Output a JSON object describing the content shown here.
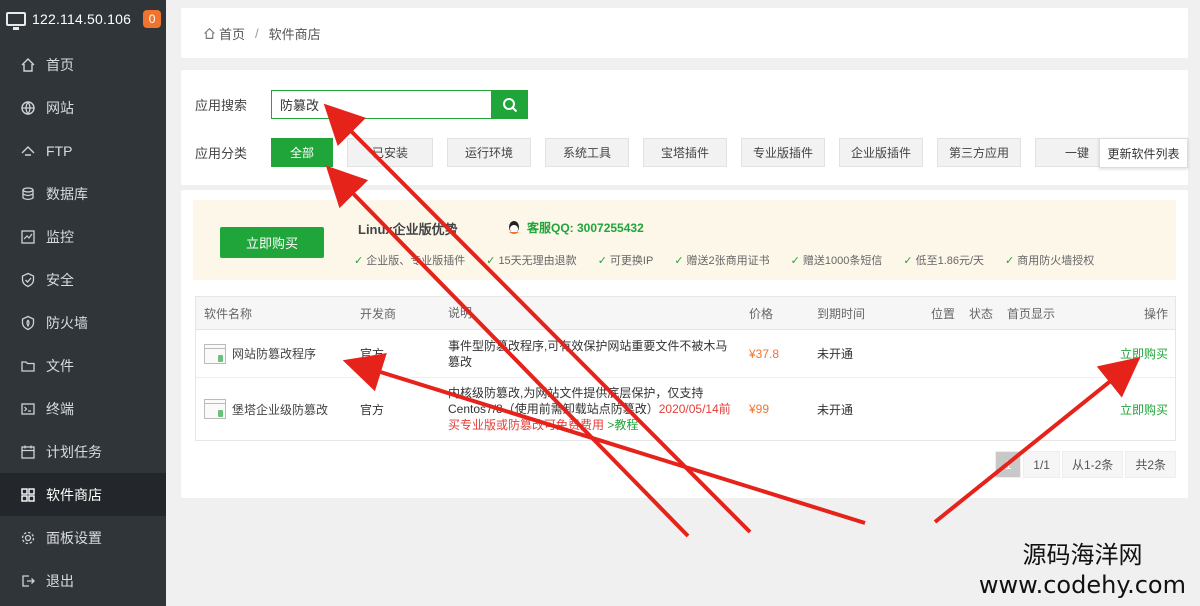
{
  "header": {
    "ip": "122.114.50.106",
    "badge": "0"
  },
  "sidebar": {
    "items": [
      {
        "label": "首页",
        "icon": "home-icon"
      },
      {
        "label": "网站",
        "icon": "globe-icon"
      },
      {
        "label": "FTP",
        "icon": "ftp-icon"
      },
      {
        "label": "数据库",
        "icon": "database-icon"
      },
      {
        "label": "监控",
        "icon": "monitor-icon"
      },
      {
        "label": "安全",
        "icon": "shield-check-icon"
      },
      {
        "label": "防火墙",
        "icon": "firewall-icon"
      },
      {
        "label": "文件",
        "icon": "folder-icon"
      },
      {
        "label": "终端",
        "icon": "terminal-icon"
      },
      {
        "label": "计划任务",
        "icon": "calendar-icon"
      },
      {
        "label": "软件商店",
        "icon": "grid-icon"
      },
      {
        "label": "面板设置",
        "icon": "gear-icon"
      },
      {
        "label": "退出",
        "icon": "logout-icon"
      }
    ],
    "active_index": 10
  },
  "breadcrumb": {
    "home": "首页",
    "current": "软件商店",
    "separator": "/"
  },
  "search": {
    "label": "应用搜索",
    "value": "防篡改"
  },
  "categories": {
    "label": "应用分类",
    "items": [
      "全部",
      "已安装",
      "运行环境",
      "系统工具",
      "宝塔插件",
      "专业版插件",
      "企业版插件",
      "第三方应用",
      "一键"
    ],
    "active_index": 0,
    "update_label": "更新软件列表"
  },
  "promo": {
    "buy_label": "立即购买",
    "title": "Linux企业版优势",
    "qq": "客服QQ: 3007255432",
    "features": [
      "企业版、专业版插件",
      "15天无理由退款",
      "可更换IP",
      "赠送2张商用证书",
      "赠送1000条短信",
      "低至1.86元/天",
      "商用防火墙授权"
    ]
  },
  "table": {
    "headers": {
      "name": "软件名称",
      "dev": "开发商",
      "desc": "说明",
      "price": "价格",
      "expire": "到期时间",
      "pos": "位置",
      "status": "状态",
      "home": "首页显示",
      "op": "操作"
    },
    "rows": [
      {
        "name": "网站防篡改程序",
        "dev": "官方",
        "desc": "事件型防篡改程序,可有效保护网站重要文件不被木马篡改",
        "price": "¥37.8",
        "expire": "未开通",
        "op": "立即购买"
      },
      {
        "name": "堡塔企业级防篡改",
        "dev": "官方",
        "desc_a": "内核级防篡改,为网站文件提供底层保护，仅支持Centos7/8（使用前需卸载站点防篡改）",
        "desc_b": "2020/05/14前买专业版或防篡改可免费费用",
        "desc_c": ">教程",
        "price": "¥99",
        "expire": "未开通",
        "op": "立即购买"
      }
    ]
  },
  "pager": {
    "current": "1",
    "pages": "1/1",
    "range": "从1-2条",
    "total": "共2条"
  },
  "watermark": {
    "line1": "源码海洋网",
    "line2": "www.codehy.com"
  },
  "colors": {
    "accent": "#20a53a",
    "sidebar": "#30353a",
    "price": "#f0742d",
    "arrow": "#e5231b"
  }
}
